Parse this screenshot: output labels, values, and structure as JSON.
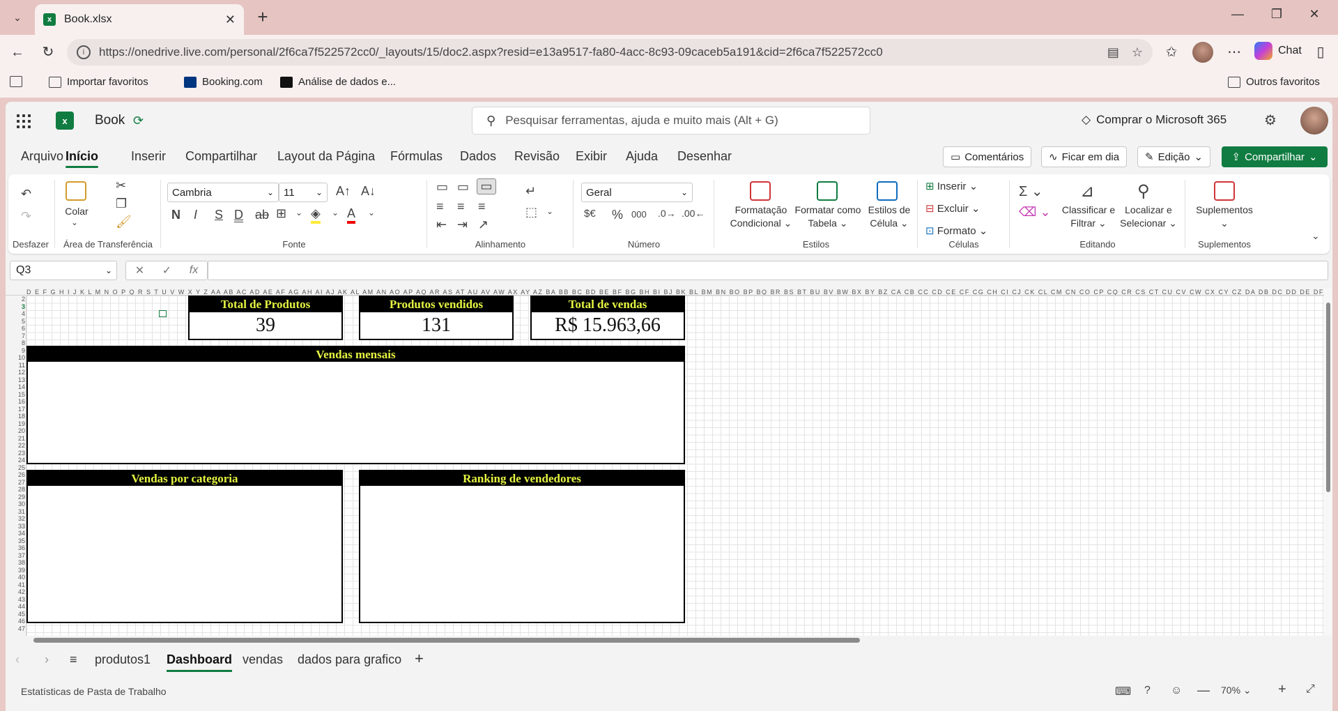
{
  "browser": {
    "tab_title": "Book.xlsx",
    "url": "https://onedrive.live.com/personal/2f6ca7f522572cc0/_layouts/15/doc2.aspx?resid=e13a9517-fa80-4acc-8c93-09caceb5a191&cid=2f6ca7f522572cc0",
    "chat_label": "Chat",
    "favorites": [
      "Importar favoritos",
      "Booking.com",
      "Análise de dados e..."
    ],
    "other_favorites": "Outros favoritos"
  },
  "app": {
    "book_name": "Book",
    "search_placeholder": "Pesquisar ferramentas, ajuda e muito mais (Alt + G)",
    "buy_label": "Comprar o Microsoft 365"
  },
  "menu": {
    "items": [
      "Arquivo",
      "Início",
      "Inserir",
      "Compartilhar",
      "Layout da Página",
      "Fórmulas",
      "Dados",
      "Revisão",
      "Exibir",
      "Ajuda",
      "Desenhar"
    ],
    "comments": "Comentários",
    "catch_up": "Ficar em dia",
    "editing": "Edição",
    "share": "Compartilhar"
  },
  "ribbon": {
    "undo_group": "Desfazer",
    "paste": "Colar",
    "clipboard_group": "Área de Transferência",
    "font_name": "Cambria",
    "font_size": "11",
    "bold": "N",
    "font_group": "Fonte",
    "align_group": "Alinhamento",
    "number_format": "Geral",
    "number_group": "Número",
    "cond_format_1": "Formatação",
    "cond_format_2": "Condicional",
    "format_table_1": "Formatar como",
    "format_table_2": "Tabela",
    "cell_styles_1": "Estilos de",
    "cell_styles_2": "Célula",
    "styles_group": "Estilos",
    "insert": "Inserir",
    "delete": "Excluir",
    "format": "Formato",
    "cells_group": "Células",
    "sort_1": "Classificar e",
    "sort_2": "Filtrar",
    "find_1": "Localizar e",
    "find_2": "Selecionar",
    "editing_group": "Editando",
    "addins": "Suplementos",
    "addins_group": "Suplementos",
    "currency": "$€",
    "percent": "%",
    "thousands": "000"
  },
  "formula_bar": {
    "name_box": "Q3",
    "fx": "fx",
    "value": ""
  },
  "sheet": {
    "column_headers": "D E F G H I J K L M N O P Q R S T U V W X Y Z AA AB AC AD AE AF AG AH AI AJ AK AL AM AN AO AP AQ AR AS AT AU AV AW AX AY AZ BA BB BC BD BE BF BG BH BI BJ BK BL BM BN BO BP BQ BR BS BT BU BV BW BX BY BZ CA CB CC CD CE CF CG CH CI CJ CK CL CM CN CO CP CQ CR CS CT CU CV CW CX CY CZ DA DB DC DD DE DF DG DH DI DJ DK DL DM DN DO DP DQ DR DS DT DU DV DW DX DY DZ EA EB EC ED EE EF EG EH EI EJ EK EL EM EN EO EP EQ ER ES ET EU EV EW EX EY",
    "rows_start": 2,
    "rows_end": 47,
    "kpis": [
      {
        "title": "Total de Produtos",
        "value": "39"
      },
      {
        "title": "Produtos vendidos",
        "value": "131"
      },
      {
        "title": "Total de vendas",
        "value": "R$ 15.963,66"
      }
    ],
    "panels": {
      "monthly": "Vendas mensais",
      "category": "Vendas por categoria",
      "ranking": "Ranking de vendedores"
    }
  },
  "sheet_tabs": [
    "produtos1",
    "Dashboard",
    "vendas",
    "dados para grafico"
  ],
  "active_sheet": "Dashboard",
  "status": {
    "left": "Estatísticas de Pasta de Trabalho",
    "zoom": "70%"
  },
  "colors": {
    "excel_green": "#107c41",
    "header_black": "#000000",
    "header_text": "#e5f542"
  }
}
